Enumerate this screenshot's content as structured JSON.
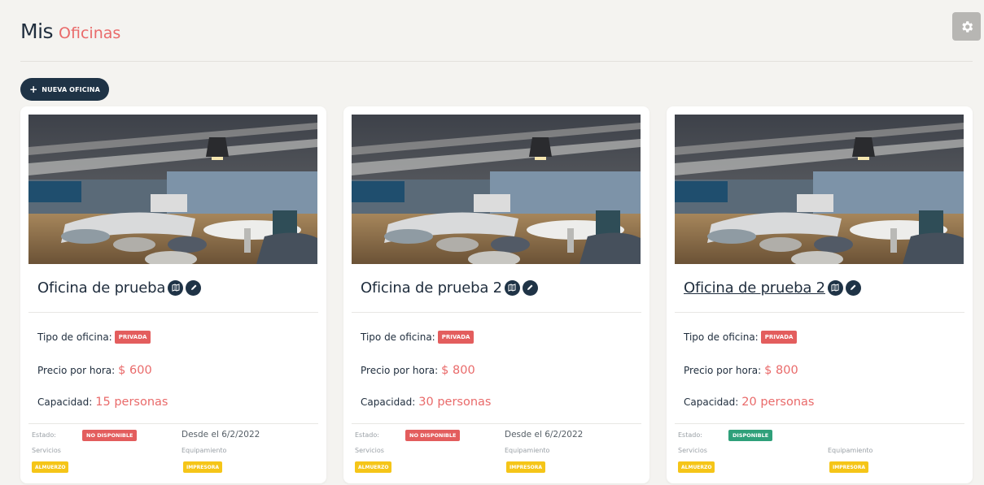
{
  "header": {
    "title_main": "Mis",
    "title_accent": "Oficinas",
    "settings_icon": "gear-icon"
  },
  "toolbar": {
    "new_office_label": "NUEVA OFICINA",
    "new_office_icon": "plus-icon"
  },
  "labels": {
    "tipo": "Tipo de oficina:",
    "precio": "Precio por hora:",
    "capacidad": "Capacidad:",
    "estado": "Estado:",
    "servicios": "Servicios",
    "equipamiento": "Equipamiento"
  },
  "colors": {
    "navy": "#1f3346",
    "accent": "#e96a6a",
    "badge_red": "#e35d5d",
    "badge_green": "#2fa07a",
    "badge_yellow": "#f5c518"
  },
  "offices": [
    {
      "name": "Oficina de prueba",
      "tipo": "PRIVADA",
      "precio": "$ 600",
      "capacidad": "15 personas",
      "estado": "NO DISPONIBLE",
      "desde": "Desde el 6/2/2022",
      "servicio": "ALMUERZO",
      "equipamiento": "IMPRESORA"
    },
    {
      "name": "Oficina de prueba 2",
      "tipo": "PRIVADA",
      "precio": "$ 800",
      "capacidad": "30 personas",
      "estado": "NO DISPONIBLE",
      "desde": "Desde el 6/2/2022",
      "servicio": "ALMUERZO",
      "equipamiento": "IMPRESORA"
    },
    {
      "name": "Oficina de prueba 2",
      "tipo": "PRIVADA",
      "precio": "$ 800",
      "capacidad": "20 personas",
      "estado": "DISPONIBLE",
      "desde": "",
      "servicio": "ALMUERZO",
      "equipamiento": "IMPRESORA"
    }
  ]
}
